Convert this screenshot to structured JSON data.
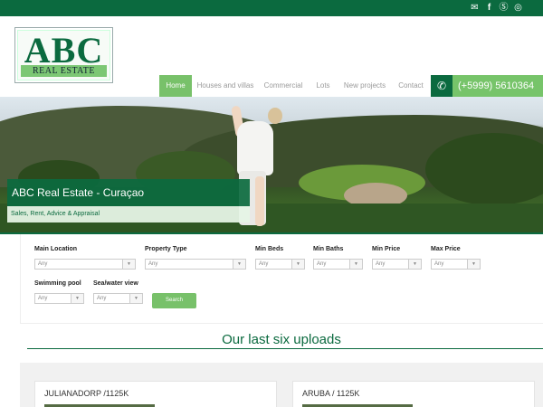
{
  "header": {
    "social_icons": [
      "mail-icon",
      "facebook-icon",
      "skype-icon",
      "whatsapp-icon"
    ]
  },
  "logo": {
    "main": "ABC",
    "sub": "REAL ESTATE"
  },
  "nav": {
    "items": [
      {
        "label": "Home",
        "active": true
      },
      {
        "label": "Houses and villas",
        "active": false
      },
      {
        "label": "Commercial",
        "active": false
      },
      {
        "label": "Lots",
        "active": false
      },
      {
        "label": "New projects",
        "active": false
      },
      {
        "label": "Contact",
        "active": false
      }
    ],
    "phone": "(+5999) 5610364"
  },
  "hero": {
    "title": "ABC Real Estate - Curaçao",
    "subtitle": "Sales, Rent, Advice & Appraisal"
  },
  "search": {
    "main_location": {
      "label": "Main Location",
      "value": "Any"
    },
    "property_type": {
      "label": "Property Type",
      "value": "Any"
    },
    "min_beds": {
      "label": "Min Beds",
      "value": "Any"
    },
    "min_baths": {
      "label": "Min Baths",
      "value": "Any"
    },
    "min_price": {
      "label": "Min Price",
      "value": "Any"
    },
    "max_price": {
      "label": "Max Price",
      "value": "Any"
    },
    "swimming_pool": {
      "label": "Swimming pool",
      "value": "Any"
    },
    "sea_view": {
      "label": "Sea/water view",
      "value": "Any"
    },
    "button": "Search"
  },
  "uploads": {
    "title": "Our last six uploads",
    "cards": [
      {
        "title": "JULIANADORP /1125K"
      },
      {
        "title": "ARUBA / 1125K"
      }
    ]
  },
  "colors": {
    "brand_green": "#0b6a3f",
    "accent_green": "#78c16a"
  }
}
